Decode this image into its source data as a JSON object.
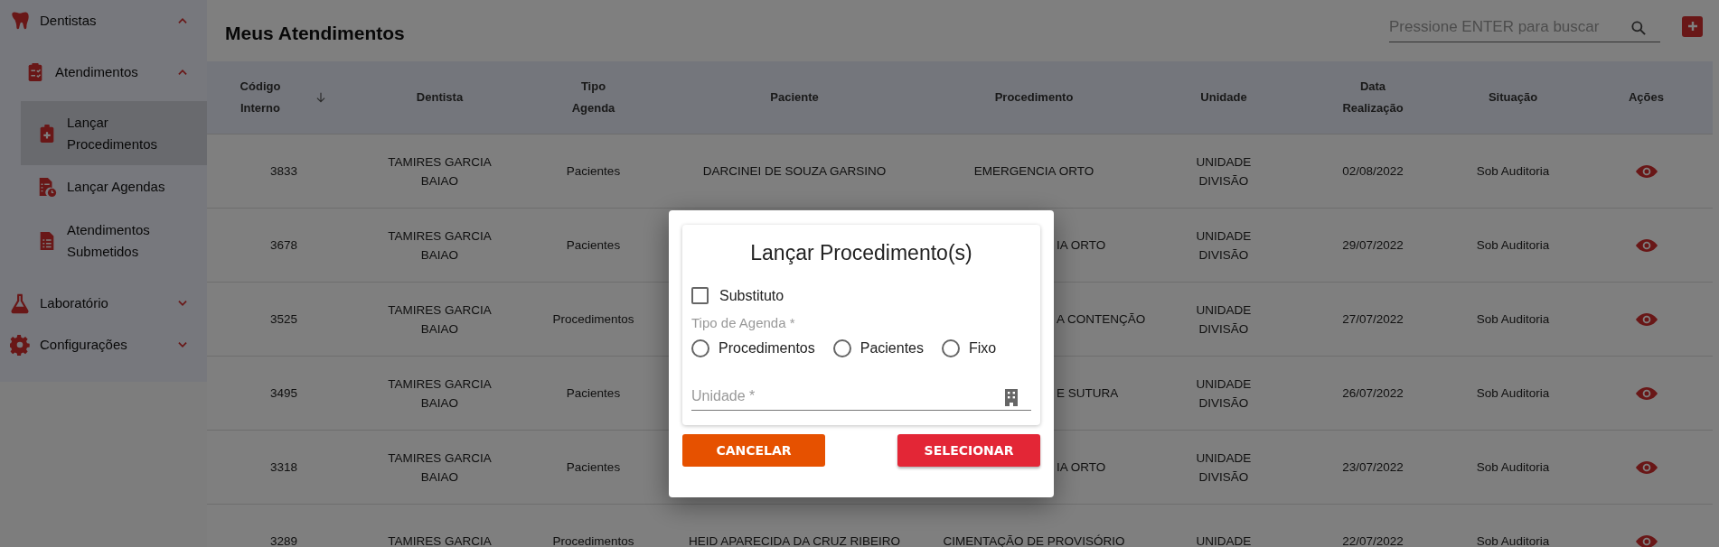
{
  "sidebar": {
    "items": [
      {
        "label": "Dentistas",
        "expanded": true,
        "children": [
          {
            "label": "Atendimentos",
            "expanded": true,
            "children": [
              {
                "label": "Lançar Procedimentos",
                "selected": true
              },
              {
                "label": "Lançar Agendas",
                "selected": false
              },
              {
                "label": "Atendimentos Submetidos",
                "selected": false
              }
            ]
          }
        ]
      },
      {
        "label": "Laboratório",
        "expanded": false
      },
      {
        "label": "Configurações",
        "expanded": false
      }
    ]
  },
  "page": {
    "title": "Meus Atendimentos",
    "search": {
      "placeholder": "Pressione ENTER para buscar"
    }
  },
  "table": {
    "columns": [
      {
        "label": "Código Interno",
        "sorted_descending": true
      },
      {
        "label": "Dentista",
        "sorted_descending": false
      },
      {
        "label": "Tipo Agenda",
        "sorted_descending": false
      },
      {
        "label": "Paciente",
        "sorted_descending": false
      },
      {
        "label": "Procedimento",
        "sorted_descending": false
      },
      {
        "label": "Unidade",
        "sorted_descending": false
      },
      {
        "label": "Data Realização",
        "sorted_descending": false
      },
      {
        "label": "Situação",
        "sorted_descending": false
      },
      {
        "label": "Ações",
        "sorted_descending": false
      }
    ],
    "rows": [
      {
        "codigo": "3833",
        "dentista": "TAMIRES GARCIA BAIAO",
        "tipo_agenda": "Pacientes",
        "paciente": "DARCINEI DE SOUZA GARSINO",
        "procedimento": "EMERGENCIA ORTO",
        "unidade": "UNIDADE DIVISÃO",
        "data_realizacao": "02/08/2022",
        "situacao": "Sob Auditoria",
        "covered": false
      },
      {
        "codigo": "3678",
        "dentista": "TAMIRES GARCIA BAIAO",
        "tipo_agenda": "Pacientes",
        "procedimento": "IA ORTO",
        "unidade": "UNIDADE DIVISÃO",
        "data_realizacao": "29/07/2022",
        "situacao": "Sob Auditoria",
        "covered": true
      },
      {
        "codigo": "3525",
        "dentista": "TAMIRES GARCIA BAIAO",
        "tipo_agenda": "Procedimentos",
        "procedimento": "A CONTENÇÃO",
        "unidade": "UNIDADE DIVISÃO",
        "data_realizacao": "27/07/2022",
        "situacao": "Sob Auditoria",
        "covered": true
      },
      {
        "codigo": "3495",
        "dentista": "TAMIRES GARCIA BAIAO",
        "tipo_agenda": "Pacientes",
        "procedimento": "E SUTURA",
        "unidade": "UNIDADE DIVISÃO",
        "data_realizacao": "26/07/2022",
        "situacao": "Sob Auditoria",
        "covered": true
      },
      {
        "codigo": "3318",
        "dentista": "TAMIRES GARCIA BAIAO",
        "tipo_agenda": "Pacientes",
        "procedimento": "IA ORTO",
        "unidade": "UNIDADE DIVISÃO",
        "data_realizacao": "23/07/2022",
        "situacao": "Sob Auditoria",
        "covered": true
      },
      {
        "codigo": "3289",
        "dentista": "TAMIRES GARCIA",
        "tipo_agenda": "Procedimentos",
        "paciente": "HEID APARECIDA DA CRUZ RIBEIRO",
        "procedimento": "CIMENTAÇÃO DE PROVISÓRIO",
        "unidade": "UNIDADE",
        "data_realizacao": "22/07/2022",
        "situacao": "Sob Auditoria",
        "covered": false
      }
    ]
  },
  "dialog": {
    "title": "Lançar Procedimento(s)",
    "checkbox": {
      "label": "Substituto",
      "checked": false
    },
    "radio_group": {
      "label": "Tipo de Agenda *",
      "options": [
        {
          "label": "Procedimentos",
          "selected": false
        },
        {
          "label": "Pacientes",
          "selected": false
        },
        {
          "label": "Fixo",
          "selected": false
        }
      ]
    },
    "field": {
      "placeholder": "Unidade *"
    },
    "buttons": [
      {
        "label": "CANCELAR",
        "kind": "cancel"
      },
      {
        "label": "SELECIONAR",
        "kind": "confirm"
      }
    ]
  }
}
